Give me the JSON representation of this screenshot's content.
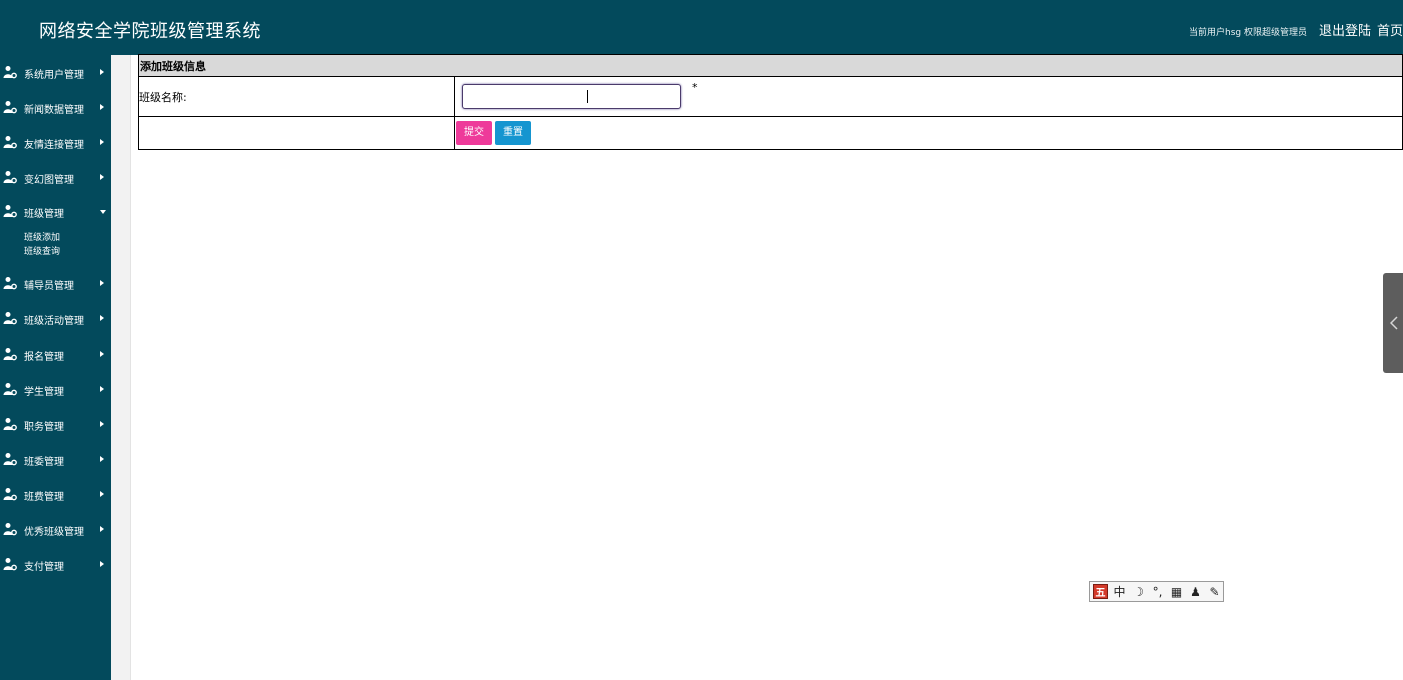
{
  "header": {
    "app_title": "网络安全学院班级管理系统",
    "user_info": "当前用户hsg  权限超级管理员",
    "logout_label": "退出登陆",
    "home_label": "首页"
  },
  "sidebar": {
    "items": [
      {
        "label": "系统用户管理",
        "expanded": false
      },
      {
        "label": "新闻数据管理",
        "expanded": false
      },
      {
        "label": "友情连接管理",
        "expanded": false
      },
      {
        "label": "变幻图管理",
        "expanded": false
      },
      {
        "label": "班级管理",
        "expanded": true,
        "children": [
          "班级添加",
          "班级查询"
        ]
      },
      {
        "label": "辅导员管理",
        "expanded": false
      },
      {
        "label": "班级活动管理",
        "expanded": false
      },
      {
        "label": "报名管理",
        "expanded": false
      },
      {
        "label": "学生管理",
        "expanded": false
      },
      {
        "label": "职务管理",
        "expanded": false
      },
      {
        "label": "班委管理",
        "expanded": false
      },
      {
        "label": "班费管理",
        "expanded": false
      },
      {
        "label": "优秀班级管理",
        "expanded": false
      },
      {
        "label": "支付管理",
        "expanded": false
      }
    ]
  },
  "form": {
    "title": "添加班级信息",
    "class_name_label": "班级名称:",
    "class_name_value": "",
    "required_mark": "*",
    "submit_label": "提交",
    "reset_label": "重置"
  },
  "ime_toolbar": {
    "items": [
      "五",
      "中",
      "☽",
      "°,",
      "▦",
      "♟",
      "✎"
    ]
  },
  "colors": {
    "header_bg": "#034a5c",
    "sidebar_bg": "#034a5c",
    "submit_btn": "#ee3a9a",
    "reset_btn": "#1595d0",
    "form_head_bg": "#d9d9d9"
  }
}
